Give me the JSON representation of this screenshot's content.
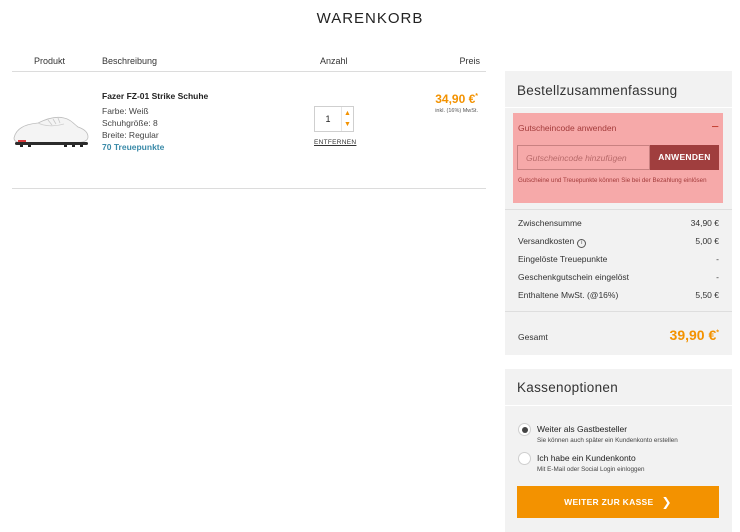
{
  "page": {
    "title": "WARENKORB"
  },
  "cart": {
    "headers": {
      "product": "Produkt",
      "description": "Beschreibung",
      "quantity": "Anzahl",
      "price": "Preis"
    },
    "item": {
      "name": "Fazer FZ-01 Strike Schuhe",
      "color": "Farbe: Weiß",
      "size": "Schuhgröße: 8",
      "width": "Breite: Regular",
      "points": "70 Treuepunkte",
      "quantity": "1",
      "remove_label": "ENTFERNEN",
      "price": "34,90 €",
      "price_marker": "*",
      "price_tax": "inkl. (16%) MwSt."
    }
  },
  "summary": {
    "title": "Bestellzusammenfassung",
    "coupon": {
      "heading": "Gutscheincode anwenden",
      "toggle": "−",
      "placeholder": "Gutscheincode hinzufügen",
      "button": "ANWENDEN",
      "note": "Gutscheine und Treuepunkte können Sie bei der Bezahlung einlösen"
    },
    "rows": [
      {
        "label": "Zwischensumme",
        "value": "34,90 €"
      },
      {
        "label": "Versandkosten",
        "value": "5,00 €",
        "info_icon": "i"
      },
      {
        "label": "Eingelöste Treuepunkte",
        "value": "-"
      },
      {
        "label": "Geschenkgutschein eingelöst",
        "value": "-"
      },
      {
        "label": "Enthaltene MwSt. (@16%)",
        "value": "5,50 €"
      }
    ],
    "total": {
      "label": "Gesamt",
      "value": "39,90 €",
      "marker": "*"
    }
  },
  "checkout": {
    "title": "Kassenoptionen",
    "options": [
      {
        "title": "Weiter als Gastbesteller",
        "subtitle": "Sie können auch später ein Kundenkonto erstellen",
        "selected": true
      },
      {
        "title": "Ich habe ein Kundenkonto",
        "subtitle": "Mit E-Mail oder Social Login einloggen",
        "selected": false
      }
    ],
    "button": "WEITER ZUR KASSE"
  },
  "colors": {
    "accent": "#f39200",
    "coupon_bg": "#f6a9a9",
    "coupon_button": "#a03e3e",
    "points": "#3a8aa8",
    "panel": "#f2f2f2"
  }
}
